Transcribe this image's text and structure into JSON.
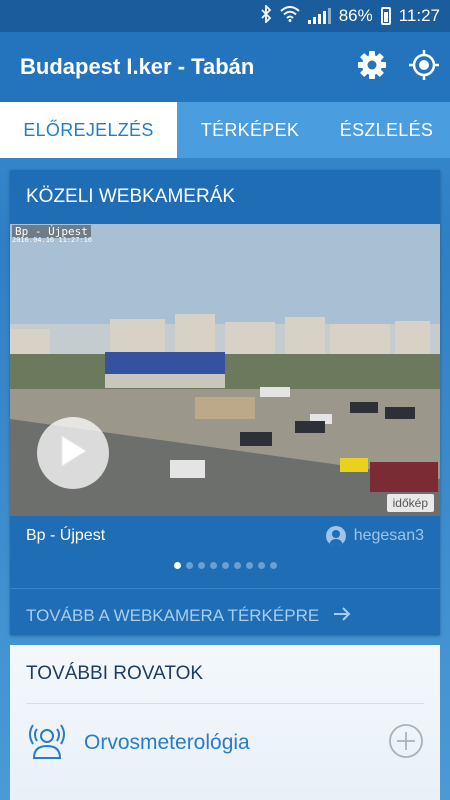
{
  "status_bar": {
    "battery": "86%",
    "time": "11:27",
    "icons": [
      "bluetooth-icon",
      "wifi-icon",
      "signal-icon",
      "battery-icon"
    ]
  },
  "app_bar": {
    "title": "Budapest I.ker - Tabán",
    "actions": [
      "gear-icon",
      "location-target-icon"
    ]
  },
  "tabs": [
    {
      "label": "ELŐREJELZÉS",
      "active": true
    },
    {
      "label": "TÉRKÉPEK",
      "active": false
    },
    {
      "label": "ÉSZLELÉS",
      "active": false
    }
  ],
  "webcams_card": {
    "title": "KÖZELI WEBKAMERÁK",
    "overlay_label": "Bp - Újpest",
    "overlay_timestamp": "2016.04.16 11:27:16",
    "logo_text": "időkép",
    "cam_name": "Bp - Újpest",
    "cam_user": "hegesan3",
    "carousel": {
      "count": 9,
      "active_index": 0
    },
    "map_link": "TOVÁBB A WEBKAMERA TÉRKÉPRE"
  },
  "more_card": {
    "title": "TOVÁBBI ROVATOK",
    "items": [
      {
        "label": "Orvosmeterológia",
        "icon": "person-signal-icon"
      }
    ]
  },
  "colors": {
    "status_bar": "#1b5d9c",
    "app_bar": "#2473bd",
    "tabs_bg": "#4a9ee0",
    "active_tab_text": "#1f7fc9",
    "card_bg": "#1f6db5"
  }
}
